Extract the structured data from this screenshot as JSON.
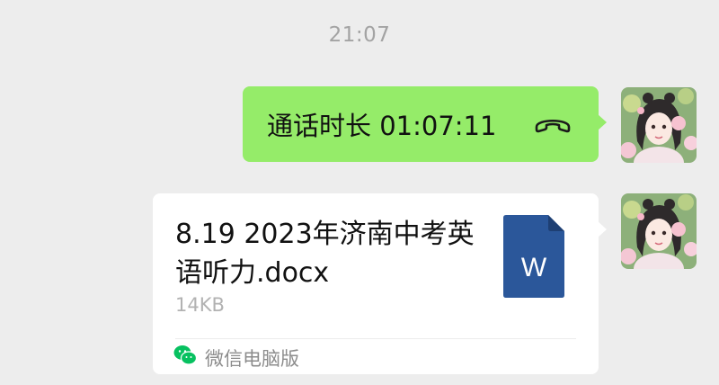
{
  "chat": {
    "timestamp": "21:07",
    "call_message": {
      "text": "通话时长 01:07:11",
      "icon": "phone-hangup-icon",
      "bubble_color": "#95ec69"
    },
    "file_message": {
      "file_name": "8.19 2023年济南中考英语听力.docx",
      "file_size": "14KB",
      "file_type_icon": "word-doc-icon",
      "file_icon_letter": "W",
      "file_icon_color": "#2b579a",
      "source_icon": "wechat-icon",
      "source_label": "微信电脑版"
    }
  },
  "colors": {
    "background": "#ededed",
    "card": "#ffffff",
    "wechat_green": "#07c160"
  }
}
